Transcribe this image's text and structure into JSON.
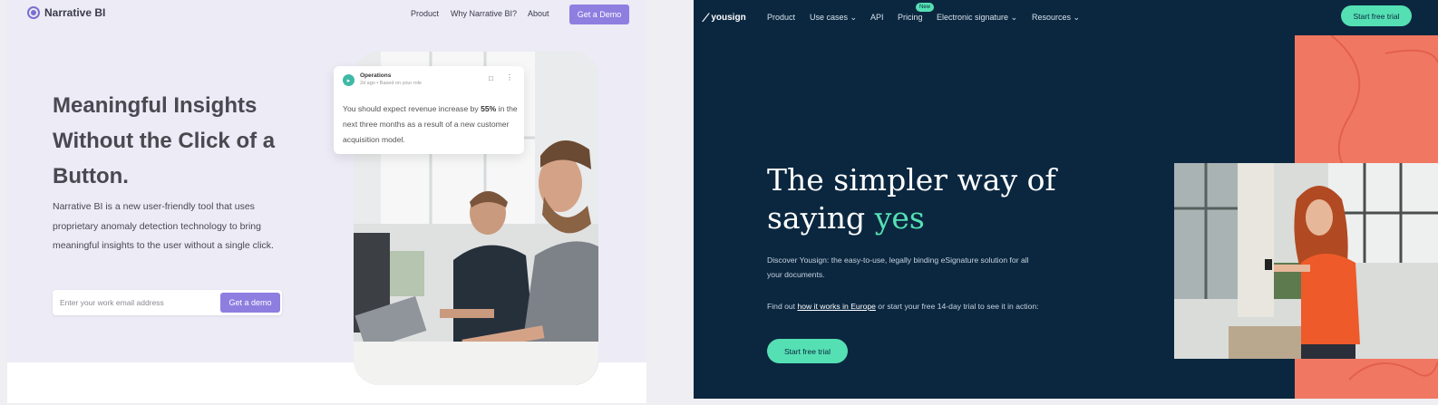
{
  "narrative_bi": {
    "brand": "Narrative BI",
    "nav": {
      "product": "Product",
      "why": "Why Narrative BI?",
      "about": "About",
      "cta": "Get a Demo"
    },
    "hero": {
      "title_line1": "Meaningful Insights",
      "title_line2": "Without the Click of a",
      "title_line3": "Button.",
      "description": "Narrative BI is a new user-friendly tool that uses proprietary anomaly detection technology to bring meaningful insights to the user without a single click."
    },
    "form": {
      "placeholder": "Enter your work email address",
      "button": "Get a demo"
    },
    "insight_card": {
      "title": "Operations",
      "meta": "2d ago • Based on your role",
      "text_before": "You should expect revenue increase by ",
      "highlight": "55%",
      "text_after": " in the next three months as a result of a new customer acquisition model."
    },
    "colors": {
      "accent": "#8d7ee0",
      "background": "#ecebf6",
      "text": "#4a4950"
    }
  },
  "yousign": {
    "brand": "yousign",
    "nav": {
      "product": "Product",
      "use_cases": "Use cases",
      "api": "API",
      "pricing": "Pricing",
      "new_badge": "New",
      "electronic_signature": "Electronic signature",
      "resources": "Resources",
      "cta": "Start free trial"
    },
    "hero": {
      "title_part1": "The simpler way of saying ",
      "title_accent": "yes",
      "paragraph1": "Discover Yousign: the easy-to-use, legally binding eSignature solution for all your documents.",
      "paragraph2_before": "Find out ",
      "paragraph2_link": "how it works in Europe",
      "paragraph2_after": " or start your free 14-day trial to see it in action:",
      "button": "Start free trial"
    },
    "colors": {
      "background": "#0b2740",
      "accent": "#55e0b3",
      "coral": "#f07863"
    }
  }
}
